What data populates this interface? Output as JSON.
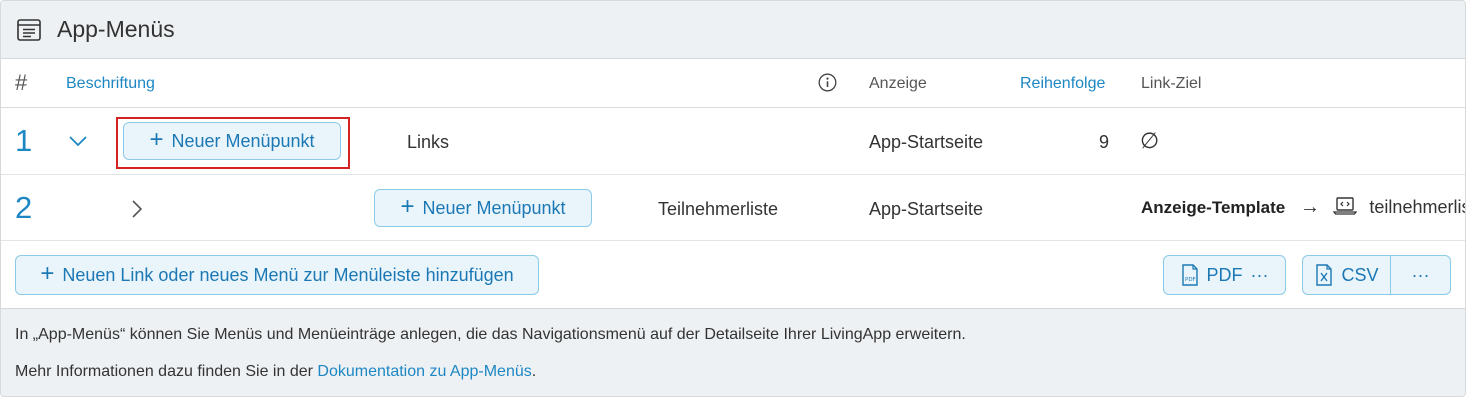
{
  "header": {
    "title": "App-Menüs",
    "icon": "menu-list-icon"
  },
  "columns": {
    "hash": "#",
    "label": "Beschriftung",
    "display": "Anzeige",
    "order": "Reihenfolge",
    "target": "Link-Ziel"
  },
  "rows": [
    {
      "number": "1",
      "expand_icon": "chevron-down-icon",
      "add_label": "Neuer Menüpunkt",
      "label": "Links",
      "display": "App-Startseite",
      "order": "9",
      "target": "∅"
    },
    {
      "number": "2",
      "expand_icon": "chevron-right-icon",
      "add_label": "Neuer Menüpunkt",
      "label": "Teilnehmerliste",
      "display": "App-Startseite",
      "order": "",
      "target_type": "Anzeige-Template",
      "target_arrow": "→",
      "target_value": "teilnehmerliste"
    }
  ],
  "toolbar": {
    "add_link_label": "Neuen Link oder neues Menü zur Menüleiste hinzufügen",
    "pdf_label": "PDF",
    "csv_label": "CSV",
    "more": "···"
  },
  "footer": {
    "info_text": "In „App-Menüs“ können Sie Menüs und Menüeinträge anlegen, die das Navigationsmenü auf der Detailseite Ihrer LivingApp erweitern.",
    "more_prefix": "Mehr Informationen dazu finden Sie in der ",
    "doc_link": "Dokumentation zu App-Menüs",
    "more_suffix": "."
  },
  "colors": {
    "accent": "#1d87c4",
    "button_bg": "#eaf5fb",
    "button_border": "#8ccbe8",
    "highlight": "#d42222"
  }
}
